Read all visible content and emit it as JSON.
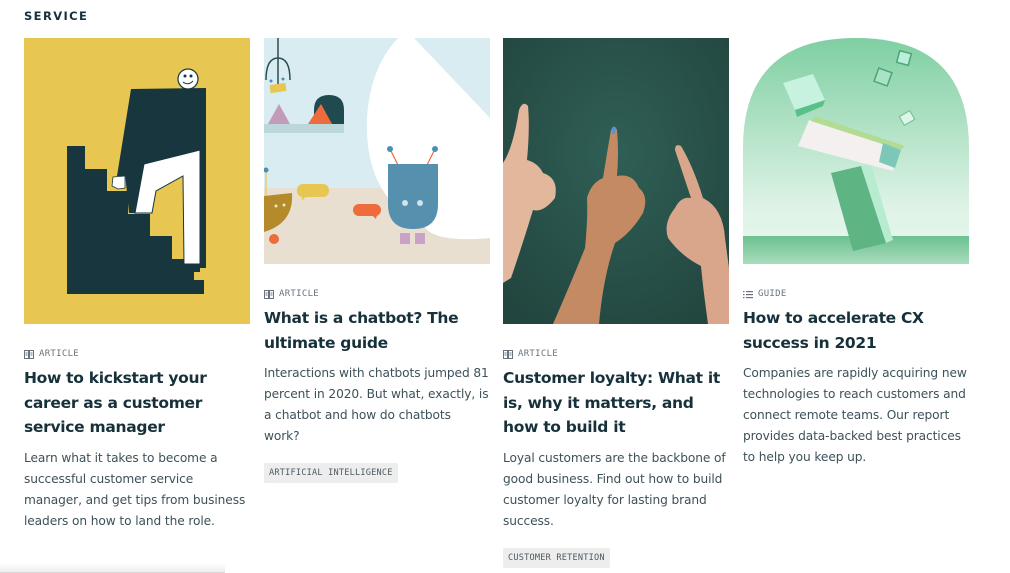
{
  "section": {
    "title": "SERVICE"
  },
  "cards": [
    {
      "type_icon": "book-icon",
      "type_label": "ARTICLE",
      "title": "How to kickstart your career as a customer service manager",
      "description": "Learn what it takes to become a successful customer service manager, and get tips from business leaders on how to land the role.",
      "tag": null,
      "image": "illustration-man-climbing-stairs",
      "image_bg": "#e8c652"
    },
    {
      "type_icon": "book-icon",
      "type_label": "ARTICLE",
      "title": "What is a chatbot? The ultimate guide",
      "description": "Interactions with chatbots jumped 81 percent in 2020. But what, exactly, is a chatbot and how do chatbots work?",
      "tag": "ARTIFICIAL INTELLIGENCE",
      "image": "illustration-chatbot-robots",
      "image_bg": "#d9ecf1"
    },
    {
      "type_icon": "book-icon",
      "type_label": "ARTICLE",
      "title": "Customer loyalty: What it is, why it matters, and how to build it",
      "description": "Loyal customers are the backbone of good business. Find out how to build customer loyalty for lasting brand success.",
      "tag": "CUSTOMER RETENTION",
      "image": "photo-hands-pointing-up",
      "image_bg": "#2b5a51"
    },
    {
      "type_icon": "list-icon",
      "type_label": "GUIDE",
      "title": "How to accelerate CX success in 2021",
      "description": "Companies are rapidly acquiring new technologies to reach customers and connect remote teams. Our report provides data-backed best practices to help you keep up.",
      "tag": null,
      "image": "illustration-green-blocks-arch",
      "image_bg": "#8fd3ad"
    }
  ]
}
